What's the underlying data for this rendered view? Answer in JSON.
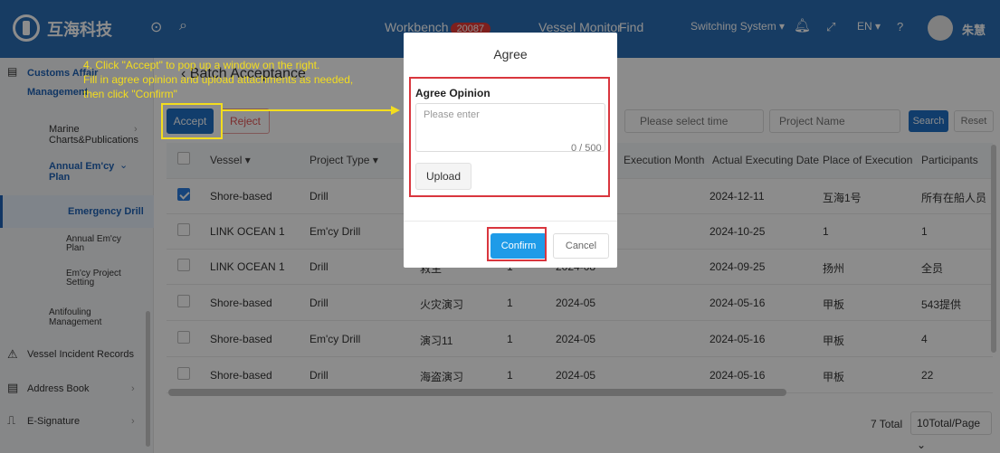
{
  "topbar": {
    "brand": "互海科技",
    "nav": {
      "workbench": "Workbench",
      "workbench_count": "20087",
      "vessel_monitor": "Vessel Monitor",
      "find": "Find"
    },
    "switching_system": "Switching System ▾",
    "lang": "EN ▾",
    "user": "朱慧",
    "icons": [
      "collapse-icon",
      "search-icon",
      "bell-icon",
      "fullscreen-icon",
      "help-icon"
    ]
  },
  "sidebar": {
    "customs_affair": "Customs Affair",
    "management": "Management",
    "items": [
      {
        "label": "Marine Charts&Publications"
      },
      {
        "label": "Annual Em'cy Plan"
      },
      {
        "label": "Emergency Drill"
      },
      {
        "label": "Annual Em'cy Plan"
      },
      {
        "label": "Em'cy Project Setting"
      },
      {
        "label": "Antifouling Management"
      },
      {
        "label": "Vessel Incident Records"
      },
      {
        "label": "Address Book"
      },
      {
        "label": "E-Signature"
      }
    ]
  },
  "page": {
    "title": "Batch Acceptance",
    "accept": "Accept",
    "reject": "Reject",
    "select_time": "Please select time",
    "project_name": "Project Name",
    "search": "Search",
    "reset": "Reset"
  },
  "table": {
    "headers": [
      "Vessel ▾",
      "Project Type ▾",
      "Execution Month",
      "Actual Executing Date",
      "Place of Execution",
      "Participants"
    ],
    "rows": [
      {
        "vessel": "Shore-based",
        "type": "Drill",
        "name": "",
        "times": "",
        "month": "",
        "date": "2024-12-11",
        "place": "互海1号",
        "participants": "所有在船人员",
        "checked": true
      },
      {
        "vessel": "LINK OCEAN 1",
        "type": "Em'cy Drill",
        "name": "",
        "times": "",
        "month": "",
        "date": "2024-10-25",
        "place": "1",
        "participants": "1",
        "checked": false
      },
      {
        "vessel": "LINK OCEAN 1",
        "type": "Drill",
        "name": "救生",
        "times": "1",
        "month": "2024-08",
        "date": "2024-09-25",
        "place": "扬州",
        "participants": "全员",
        "checked": false
      },
      {
        "vessel": "Shore-based",
        "type": "Drill",
        "name": "火灾演习",
        "times": "1",
        "month": "2024-05",
        "date": "2024-05-16",
        "place": "甲板",
        "participants": "543提供",
        "checked": false
      },
      {
        "vessel": "Shore-based",
        "type": "Em'cy Drill",
        "name": "演习11",
        "times": "1",
        "month": "2024-05",
        "date": "2024-05-16",
        "place": "甲板",
        "participants": "4",
        "checked": false
      },
      {
        "vessel": "Shore-based",
        "type": "Drill",
        "name": "海盗演习",
        "times": "1",
        "month": "2024-05",
        "date": "2024-05-16",
        "place": "甲板",
        "participants": "22",
        "checked": false
      }
    ],
    "total": "7 Total",
    "page_size": "10Total/Page ⌄"
  },
  "modal": {
    "title": "Agree",
    "label": "Agree Opinion",
    "placeholder": "Please enter",
    "count": "0 / 500",
    "upload": "Upload",
    "confirm": "Confirm",
    "cancel": "Cancel"
  },
  "annotation": "4. Click \"Accept\" to pop up a window on the right.\nFill in agree opinion and upload attachments as needed,\nthen click \"Confirm\""
}
